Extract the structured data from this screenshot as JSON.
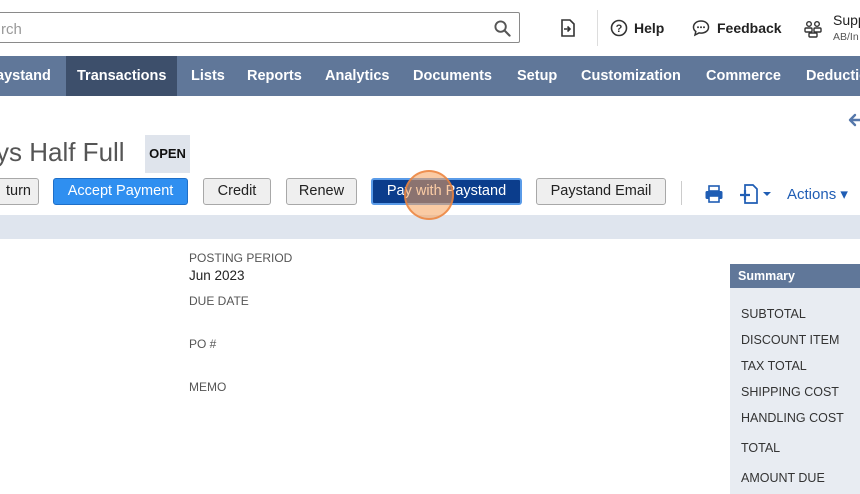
{
  "search": {
    "placeholder": "rch"
  },
  "header": {
    "help_label": "Help",
    "feedback_label": "Feedback",
    "support_label": "Supp",
    "support_sub": "AB/In"
  },
  "nav": {
    "items": [
      "aystand",
      "Transactions",
      "Lists",
      "Reports",
      "Analytics",
      "Documents",
      "Setup",
      "Customization",
      "Commerce",
      "Deductio"
    ],
    "active": "Transactions"
  },
  "record": {
    "title": "ys Half Full",
    "status": "OPEN"
  },
  "toolbar": {
    "return_label": "turn",
    "accept_payment_label": "Accept Payment",
    "credit_label": "Credit",
    "renew_label": "Renew",
    "pay_paystand_label": "Pay with Paystand",
    "paystand_email_label": "Paystand Email",
    "actions_label": "Actions ▾"
  },
  "fields": {
    "posting_period_label": "POSTING PERIOD",
    "posting_period_value": "Jun 2023",
    "due_date_label": "DUE DATE",
    "po_label": "PO #",
    "memo_label": "MEMO"
  },
  "summary": {
    "title": "Summary",
    "rows": [
      "SUBTOTAL",
      "DISCOUNT ITEM",
      "TAX TOTAL",
      "SHIPPING COST",
      "HANDLING COST",
      "TOTAL",
      "AMOUNT DUE"
    ]
  },
  "colors": {
    "nav_bg": "#607799",
    "nav_active": "#3d4f6b",
    "primary_button": "#2f8ff0",
    "paystand_button": "#0b3d8c",
    "link_blue": "#1f5db4",
    "band": "#dfe5ee"
  },
  "icons": [
    "search-icon",
    "shortcut-icon",
    "help-icon",
    "feedback-icon",
    "roles-icon",
    "back-arrow-icon",
    "print-icon",
    "add-document-icon"
  ]
}
